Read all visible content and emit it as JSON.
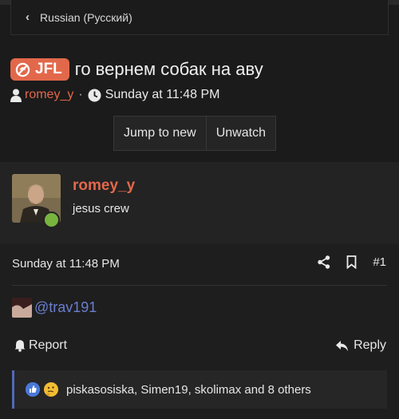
{
  "breadcrumb": {
    "label": "Russian (Русский)"
  },
  "thread": {
    "prefix": "JFL",
    "title": "го вернем собак на аву",
    "author": "romey_y",
    "separator": "·",
    "date": "Sunday at 11:48 PM"
  },
  "buttons": {
    "jump_to_new": "Jump to new",
    "unwatch": "Unwatch"
  },
  "post": {
    "username": "romey_y",
    "user_title": "jesus crew",
    "date": "Sunday at 11:48 PM",
    "number": "#1",
    "mention": "@trav191",
    "report_label": "Report",
    "reply_label": "Reply",
    "reactions_text": "piskasosiska, Simen19, skolimax and 8 others"
  },
  "colors": {
    "accent": "#e2684b",
    "mention": "#6a7fcf",
    "online": "#78b53f",
    "reaction_border": "#5268b8"
  },
  "icons": {
    "back": "chevron-left-icon",
    "prefix": "swirl-icon",
    "user": "user-icon",
    "clock": "clock-icon",
    "share": "share-icon",
    "bookmark": "bookmark-icon",
    "report": "bell-icon",
    "reply": "reply-icon",
    "like": "thumbs-up-icon",
    "think": "thinking-face-icon"
  }
}
